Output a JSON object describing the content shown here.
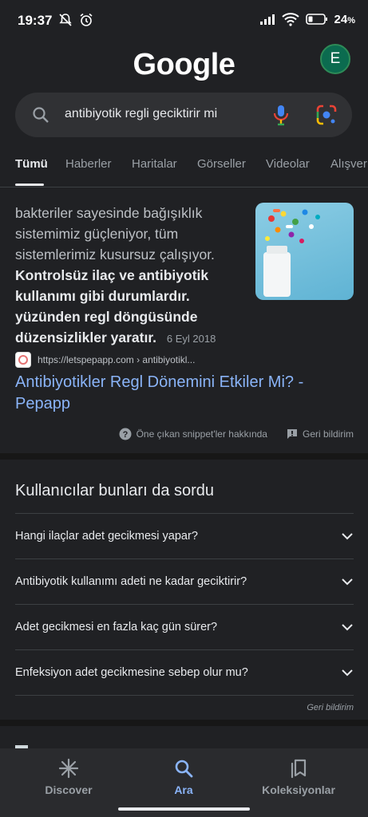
{
  "status": {
    "time": "19:37",
    "battery": "24"
  },
  "header": {
    "logo": "Google",
    "avatar_letter": "E"
  },
  "search": {
    "query": "antibiyotik regli geciktirir mi"
  },
  "tabs": [
    "Tümü",
    "Haberler",
    "Haritalar",
    "Görseller",
    "Videolar",
    "Alışver"
  ],
  "snippet": {
    "text_plain": "bakteriler sayesinde bağışıklık sistemimiz güçleniyor, tüm sistemlerimiz kusursuz çalışıyor. ",
    "text_bold": "Kontrolsüz ilaç ve antibiyotik kullanımı gibi durumlardır. yüzünden regl döngüsünde düzensizlikler yaratır",
    "text_end": ".",
    "date": "6 Eyl 2018",
    "source_url": "https://letspepapp.com › antibiyotikl...",
    "title": "Antibiyotikler Regl Dönemini Etkiler Mi? - Pepapp",
    "about": "Öne çıkan snippet'ler hakkında",
    "feedback": "Geri bildirim"
  },
  "paa": {
    "heading": "Kullanıcılar bunları da sordu",
    "questions": [
      "Hangi ilaçlar adet gecikmesi yapar?",
      "Antibiyotik kullanımı adeti ne kadar geciktirir?",
      "Adet gecikmesi en fazla kaç gün sürer?",
      "Enfeksiyon adet gecikmesine sebep olur mu?"
    ],
    "feedback": "Geri bildirim"
  },
  "nav": {
    "discover": "Discover",
    "search": "Ara",
    "collections": "Koleksiyonlar"
  },
  "colors": {
    "background": "#202124",
    "link": "#8ab4f8",
    "active_nav": "#8ab4f8"
  }
}
